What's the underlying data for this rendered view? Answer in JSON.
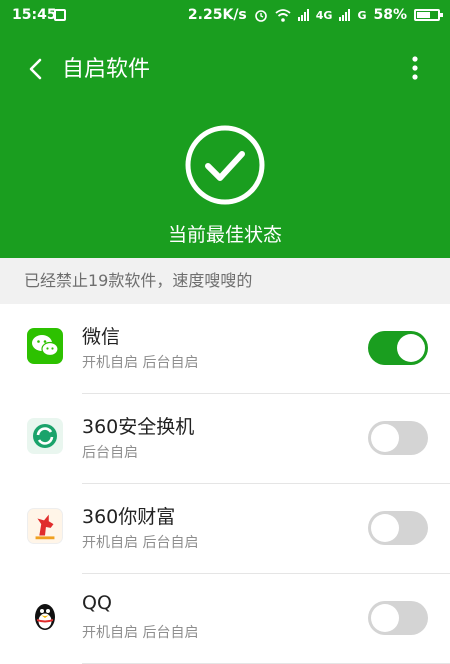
{
  "status_bar": {
    "time": "15:45",
    "speed": "2.25K/s",
    "network1": "4G",
    "network2": "G",
    "battery": "58%",
    "icons": [
      "screenshot-icon",
      "alarm-icon",
      "wifi-icon",
      "signal-icon",
      "signal-icon",
      "battery-icon"
    ]
  },
  "header": {
    "title": "自启软件",
    "status_text": "当前最佳状态",
    "icons": [
      "back-arrow-icon",
      "more-vertical-icon",
      "check-circle-icon"
    ]
  },
  "notice": "已经禁止19款软件，速度嗖嗖的",
  "apps": [
    {
      "name": "微信",
      "sub": "开机自启 后台自启",
      "enabled": true,
      "icon": "wechat-icon",
      "icon_color": "#2dc100"
    },
    {
      "name": "360安全换机",
      "sub": "后台自启",
      "enabled": false,
      "icon": "phone-transfer-icon",
      "icon_color": "#1aa36b"
    },
    {
      "name": "360你财富",
      "sub": "开机自启 后台自启",
      "enabled": false,
      "icon": "unicorn-icon",
      "icon_color": "#e02c2c"
    },
    {
      "name": "QQ",
      "sub": "开机自启 后台自启",
      "enabled": false,
      "icon": "qq-penguin-icon",
      "icon_color": "#111111"
    }
  ],
  "colors": {
    "brand_green": "#1a9e1f",
    "toggle_off": "#d4d4d4",
    "notice_bg": "#f1f1f1"
  }
}
